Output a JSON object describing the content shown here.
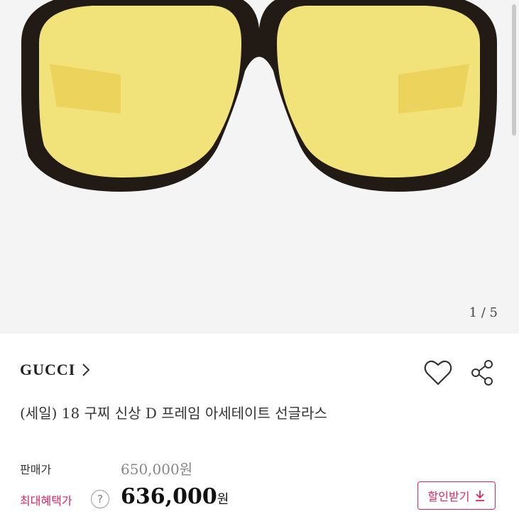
{
  "gallery": {
    "image_alt": "Gucci yellow-lens aviator sunglasses",
    "pager": "1 / 5"
  },
  "product": {
    "brand": "GUCCI",
    "title": "(세일) 18 구찌 신상 D 프레임 아세테이트 선글라스"
  },
  "pricing": {
    "sale_label": "판매가",
    "sale_price": "650,000원",
    "max_benefit_label": "최대혜택가",
    "max_benefit_price": "636,000",
    "currency": "원",
    "help_icon": "?",
    "coupon_button_label": "할인받기"
  },
  "colors": {
    "accent": "#e0245e",
    "lens": "#f2e27a",
    "frame": "#221a14"
  },
  "icons": [
    "chevron-right-icon",
    "heart-icon",
    "share-icon",
    "question-icon",
    "download-arrow-icon"
  ]
}
